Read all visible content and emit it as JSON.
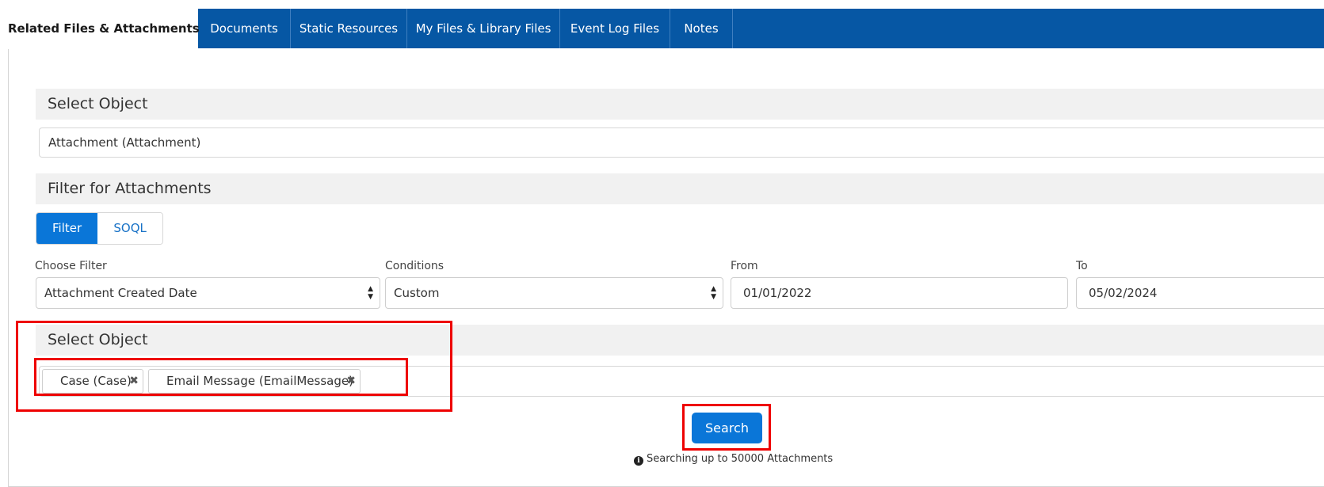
{
  "tabs": [
    {
      "label": "Related Files & Attachments",
      "active": true
    },
    {
      "label": "Documents",
      "active": false
    },
    {
      "label": "Static Resources",
      "active": false
    },
    {
      "label": "My Files & Library Files",
      "active": false
    },
    {
      "label": "Event Log Files",
      "active": false
    },
    {
      "label": "Notes",
      "active": false
    }
  ],
  "select_object": {
    "header": "Select Object",
    "value": "Attachment (Attachment)"
  },
  "filter_section": {
    "header": "Filter for Attachments",
    "modes": [
      "Filter",
      "SOQL"
    ],
    "active_mode": "Filter",
    "choose_filter": {
      "label": "Choose Filter",
      "value": "Attachment Created Date"
    },
    "conditions": {
      "label": "Conditions",
      "value": "Custom"
    },
    "from": {
      "label": "From",
      "value": "01/01/2022"
    },
    "to": {
      "label": "To",
      "value": "05/02/2024"
    }
  },
  "related_objects": {
    "header": "Select Object",
    "tags": [
      "Case (Case)",
      "Email Message (EmailMessage)"
    ]
  },
  "search": {
    "button_label": "Search",
    "note": "Searching up to 50000 Attachments"
  },
  "colors": {
    "tabbar": "#0657a4",
    "accent": "#0a76d8",
    "highlight": "#ee0000"
  },
  "icons": {
    "remove": "close-icon",
    "info": "info-icon",
    "select_arrows": "sort-arrows-icon"
  }
}
